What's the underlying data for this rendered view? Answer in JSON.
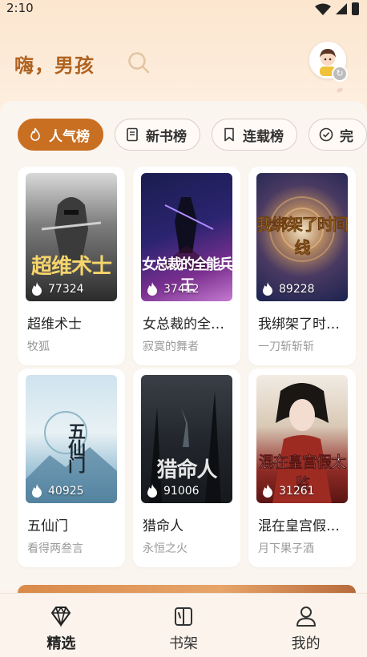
{
  "status_bar": {
    "time": "2:10"
  },
  "header": {
    "greeting": "嗨，男孩"
  },
  "tabs": [
    {
      "label": "人气榜",
      "icon": "flame-icon",
      "active": true
    },
    {
      "label": "新书榜",
      "icon": "book-icon",
      "active": false
    },
    {
      "label": "连载榜",
      "icon": "bookmark-icon",
      "active": false
    },
    {
      "label": "完",
      "icon": "check-circle-icon",
      "active": false
    }
  ],
  "books": [
    {
      "title": "超维术士",
      "author": "牧狐",
      "heat": "77324",
      "cover_text": "超维术士"
    },
    {
      "title": "女总裁的全能兵王",
      "author": "寂寞的舞者",
      "heat": "37412",
      "cover_text": "女总裁的全能兵王"
    },
    {
      "title": "我绑架了时间线",
      "author": "一刀斩斩斩",
      "heat": "89228",
      "cover_text": "我绑架了时间线"
    },
    {
      "title": "五仙门",
      "author": "看得两叁言",
      "heat": "40925",
      "cover_text": "五仙门"
    },
    {
      "title": "猎命人",
      "author": "永恒之火",
      "heat": "91006",
      "cover_text": "猎命人"
    },
    {
      "title": "混在皇宫假太监",
      "author": "月下果子酒",
      "heat": "31261",
      "cover_text": "混在皇宫假太监"
    }
  ],
  "bottom_nav": [
    {
      "label": "精选",
      "icon": "diamond-icon",
      "active": true
    },
    {
      "label": "书架",
      "icon": "bookshelf-icon",
      "active": false
    },
    {
      "label": "我的",
      "icon": "person-icon",
      "active": false
    }
  ],
  "colors": {
    "accent": "#c86f22",
    "greeting": "#b0621f"
  }
}
